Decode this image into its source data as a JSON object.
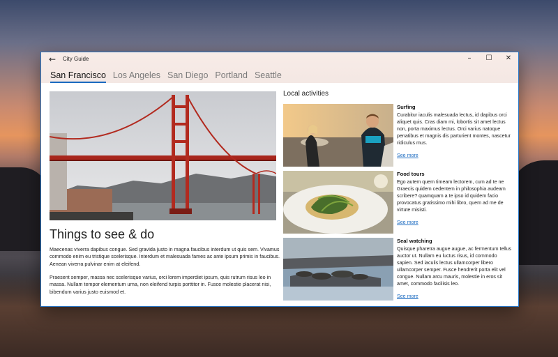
{
  "window": {
    "title": "City Guide"
  },
  "caption": {
    "back_icon": "←",
    "minimize_icon": "–",
    "maximize_icon": "☐",
    "close_icon": "✕"
  },
  "tabs": [
    {
      "label": "San Francisco"
    },
    {
      "label": "Los Angeles"
    },
    {
      "label": "San Diego"
    },
    {
      "label": "Portland"
    },
    {
      "label": "Seattle"
    }
  ],
  "main": {
    "hero_image": "golden-gate-bridge",
    "section_title": "Things to see & do",
    "paragraphs": [
      "Maecenas viverra dapibus congue. Sed gravida justo in magna faucibus interdum ut quis sem. Vivamus commodo enim eu tristique scelerisque. Interdum et malesuada fames ac ante ipsum primis in faucibus. Aenean viverra pulvinar enim at eleifend.",
      "Praesent semper, massa nec scelerisque varius, orci lorem imperdiet ipsum, quis rutrum risus leo in massa. Nullam tempor elementum urna, non eleifend turpis porttitor in. Fusce molestie placerat nisi, bibendum varius justo euismod et."
    ]
  },
  "local": {
    "title": "Local activities",
    "items": [
      {
        "name": "Surfing",
        "image": "surfers-on-beach",
        "description": "Curabitur iaculis malesuada lectus, id dapibus orci aliquet quis. Cras diam mi, lobortis sit amet lectus non, porta maximus lectus. Orci varius natoque penatibus et magnis dis parturient montes, nascetur ridiculus mus.",
        "link": "See more"
      },
      {
        "name": "Food tours",
        "image": "plated-food",
        "description": "Ego autem quem timeam lectorem, cum ad te ne Graecis quidem cedentem in philosophia audeam scribere? quamquam a te ipso id quidem facio provocatus gratissimo mihi libro, quem ad me de virtute misisti.",
        "link": "See more"
      },
      {
        "name": "Seal watching",
        "image": "seals-on-rocks",
        "description": "Quisque pharetra augue augue, ac fermentum tellus auctor ut. Nullam eu luctus risus, id commodo sapien. Sed iaculis lectus ullamcorper libero ullamcorper semper. Fusce hendrerit porta elit vel congue. Nullam arcu mauris, molestie in eros sit amet, commodo facilisis leo.",
        "link": "See more"
      }
    ]
  }
}
